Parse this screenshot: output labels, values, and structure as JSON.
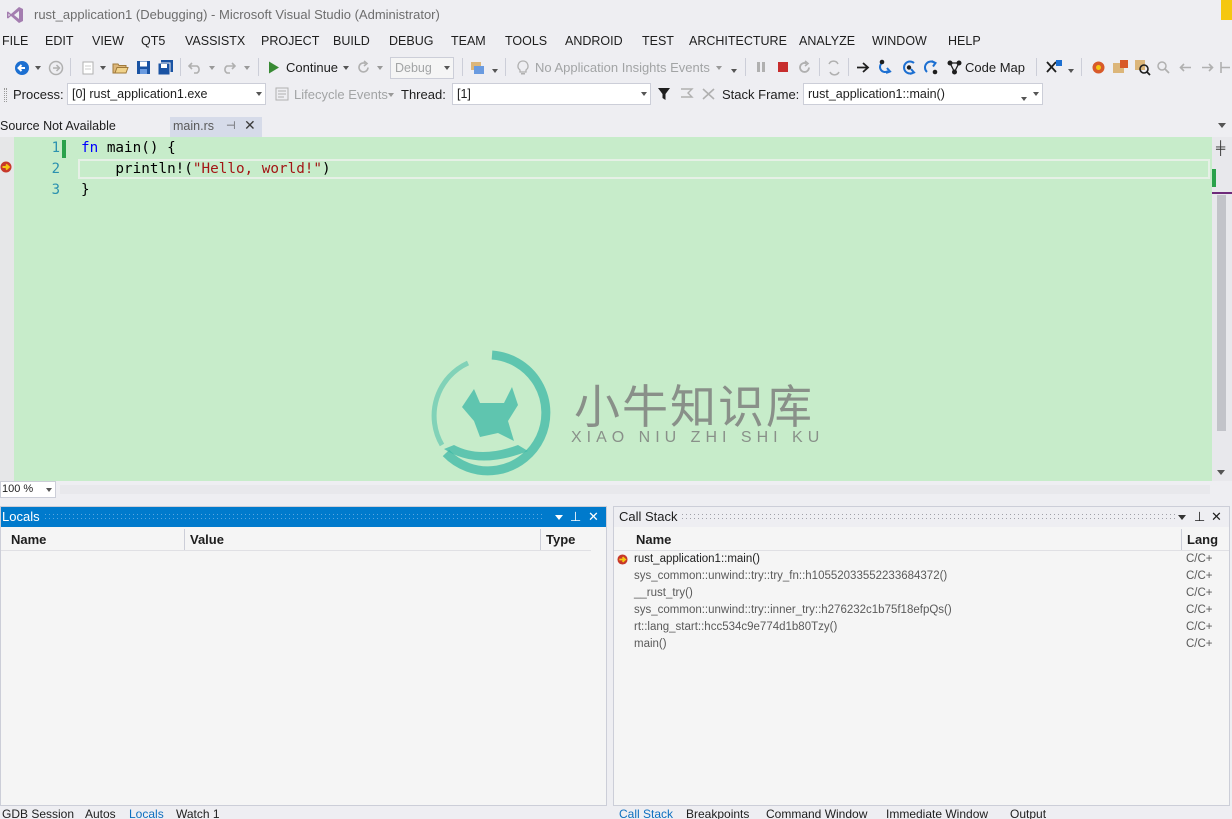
{
  "window": {
    "title": "rust_application1 (Debugging) - Microsoft Visual Studio (Administrator)"
  },
  "menu": [
    "FILE",
    "EDIT",
    "VIEW",
    "QT5",
    "VASSISTX",
    "PROJECT",
    "BUILD",
    "DEBUG",
    "TEAM",
    "TOOLS",
    "ANDROID",
    "TEST",
    "ARCHITECTURE",
    "ANALYZE",
    "WINDOW",
    "HELP"
  ],
  "toolbar": {
    "continue_label": "Continue",
    "config_value": "Debug",
    "insights_label": "No Application Insights Events",
    "code_map_label": "Code Map",
    "process_label": "Process:",
    "process_value": "[0] rust_application1.exe",
    "lifecycle_label": "Lifecycle Events",
    "thread_label": "Thread:",
    "thread_value": "[1]",
    "stack_frame_label": "Stack Frame:",
    "stack_frame_value": "rust_application1::main()"
  },
  "doc_tabs": {
    "source_not_available": "Source Not Available",
    "active_tab": "main.rs"
  },
  "editor": {
    "line_numbers": [
      "1",
      "2",
      "3"
    ],
    "code": {
      "line1_kw": "fn",
      "line1_rest": " main() {",
      "line2_pre": "    println!(",
      "line2_str": "\"Hello, world!\"",
      "line2_post": ")",
      "line3": "}"
    },
    "zoom": "100 %",
    "watermark_cn": "小牛知识库",
    "watermark_en": "XIAO NIU ZHI SHI KU"
  },
  "locals": {
    "title": "Locals",
    "columns": [
      "Name",
      "Value",
      "Type"
    ],
    "bottom_tabs": [
      "GDB Session",
      "Autos",
      "Locals",
      "Watch 1"
    ],
    "active_tab": "Locals"
  },
  "call_stack": {
    "title": "Call Stack",
    "columns": [
      "Name",
      "Lang"
    ],
    "rows": [
      {
        "name": "rust_application1::main()",
        "lang": "C/C+"
      },
      {
        "name": "sys_common::unwind::try::try_fn::h10552033552233684372()",
        "lang": "C/C+"
      },
      {
        "name": "__rust_try()",
        "lang": "C/C+"
      },
      {
        "name": "sys_common::unwind::try::inner_try::h276232c1b75f18efpQs()",
        "lang": "C/C+"
      },
      {
        "name": "rt::lang_start::hcc534c9e774d1b80Tzy()",
        "lang": "C/C+"
      },
      {
        "name": "main()",
        "lang": "C/C+"
      }
    ],
    "bottom_tabs": [
      "Call Stack",
      "Breakpoints",
      "Command Window",
      "Immediate Window",
      "Output"
    ],
    "active_tab": "Call Stack"
  },
  "colors": {
    "accent": "#007acc",
    "editor_bg": "#c7ecca",
    "breakpoint": "#f5c710"
  }
}
